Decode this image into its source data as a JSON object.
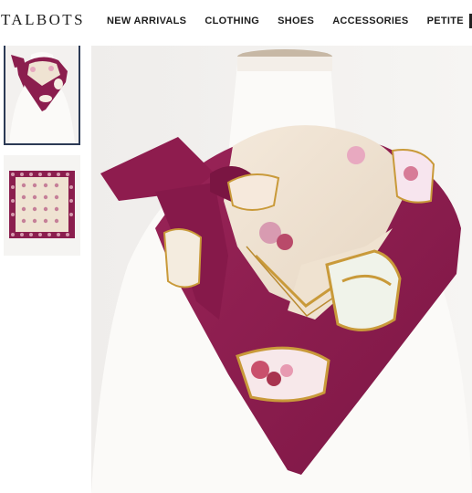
{
  "brand": {
    "name": "TALBOTS"
  },
  "nav": {
    "items": [
      {
        "label": "NEW ARRIVALS"
      },
      {
        "label": "CLOTHING"
      },
      {
        "label": "SHOES"
      },
      {
        "label": "ACCESSORIES"
      },
      {
        "label": "PETITE"
      }
    ]
  },
  "gallery": {
    "thumbnails": [
      {
        "name": "scarf-on-mannequin",
        "selected": true
      },
      {
        "name": "scarf-flat-lay",
        "selected": false
      }
    ],
    "main_image": "scarf-on-mannequin"
  },
  "colors": {
    "scarf_berry": "#8b1e4e",
    "scarf_cream": "#efe3d2",
    "accent_gold": "#c99a3a",
    "selected_border": "#2c3a55"
  }
}
